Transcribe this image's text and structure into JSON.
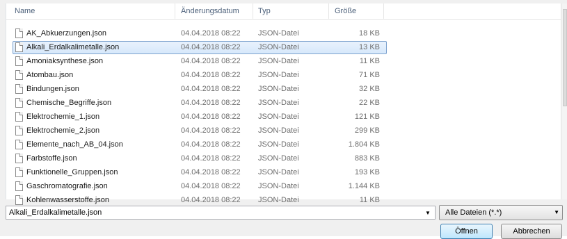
{
  "columns": {
    "name": "Name",
    "date": "Änderungsdatum",
    "type": "Typ",
    "size": "Größe"
  },
  "files": [
    {
      "name": "AK_Abkuerzungen.json",
      "date": "04.04.2018 08:22",
      "type": "JSON-Datei",
      "size": "18 KB"
    },
    {
      "name": "Alkali_Erdalkalimetalle.json",
      "date": "04.04.2018 08:22",
      "type": "JSON-Datei",
      "size": "13 KB",
      "selected": true
    },
    {
      "name": "Amoniaksynthese.json",
      "date": "04.04.2018 08:22",
      "type": "JSON-Datei",
      "size": "11 KB"
    },
    {
      "name": "Atombau.json",
      "date": "04.04.2018 08:22",
      "type": "JSON-Datei",
      "size": "71 KB"
    },
    {
      "name": "Bindungen.json",
      "date": "04.04.2018 08:22",
      "type": "JSON-Datei",
      "size": "32 KB"
    },
    {
      "name": "Chemische_Begriffe.json",
      "date": "04.04.2018 08:22",
      "type": "JSON-Datei",
      "size": "22 KB"
    },
    {
      "name": "Elektrochemie_1.json",
      "date": "04.04.2018 08:22",
      "type": "JSON-Datei",
      "size": "121 KB"
    },
    {
      "name": "Elektrochemie_2.json",
      "date": "04.04.2018 08:22",
      "type": "JSON-Datei",
      "size": "299 KB"
    },
    {
      "name": "Elemente_nach_AB_04.json",
      "date": "04.04.2018 08:22",
      "type": "JSON-Datei",
      "size": "1.804 KB"
    },
    {
      "name": "Farbstoffe.json",
      "date": "04.04.2018 08:22",
      "type": "JSON-Datei",
      "size": "883 KB"
    },
    {
      "name": "Funktionelle_Gruppen.json",
      "date": "04.04.2018 08:22",
      "type": "JSON-Datei",
      "size": "193 KB"
    },
    {
      "name": "Gaschromatografie.json",
      "date": "04.04.2018 08:22",
      "type": "JSON-Datei",
      "size": "1.144 KB"
    },
    {
      "name": "Kohlenwasserstoffe.json",
      "date": "04.04.2018 08:22",
      "type": "JSON-Datei",
      "size": "11 KB"
    }
  ],
  "filename_input": {
    "value": "Alkali_Erdalkalimetalle.json"
  },
  "filter": {
    "selected": "Alle Dateien (*.*)"
  },
  "buttons": {
    "open": "Öffnen",
    "cancel": "Abbrechen"
  },
  "icons": {
    "file": "document-icon",
    "dropdown": "chevron-down-icon"
  },
  "colors": {
    "selection": "#d6e8fb",
    "selection_border": "#7da2ce",
    "header_text": "#4c607a"
  }
}
